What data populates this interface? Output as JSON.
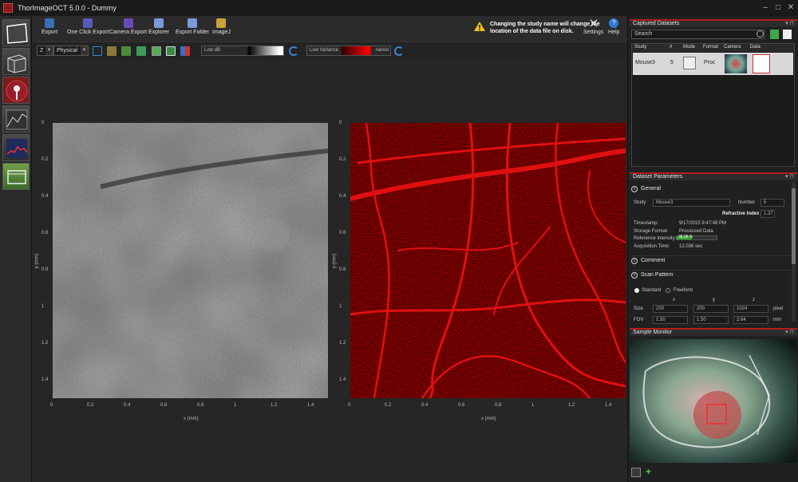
{
  "app": {
    "title": "ThorImageOCT 5.0.0 - Dummy"
  },
  "toolbar": {
    "buttons": [
      "Export",
      "One Click Export",
      "Camera Export",
      "Explorer",
      "Export Folder",
      "ImageJ"
    ],
    "warning": "Changing the study name will change the location of the data file on disk.",
    "settings": "Settings",
    "help": "Help"
  },
  "subbar": {
    "axis": "Z",
    "units": "Physical",
    "slider1": "Low dB",
    "slider2_left": "Low Variance",
    "slider2_right": "riance"
  },
  "plots": {
    "xlabel": "x (mm)",
    "ylabel": "y (mm)",
    "xticks": [
      "0",
      "0.2",
      "0.4",
      "0.6",
      "0.8",
      "1",
      "1.2",
      "1.4"
    ],
    "yticks": [
      "0",
      "0.2",
      "0.4",
      "0.6",
      "0.8",
      "1",
      "1.2",
      "1.4"
    ]
  },
  "captured": {
    "title": "Captured Datasets",
    "search_placeholder": "Search",
    "columns": [
      "Study",
      "#",
      "Mode",
      "Format",
      "Camera",
      "Data"
    ],
    "row": {
      "study": "Mouse3",
      "num": "5",
      "format": "Proc"
    }
  },
  "params": {
    "title": "Dataset Parameters",
    "general": "General",
    "study_label": "Study",
    "study_value": "Mouse3",
    "number_label": "Number",
    "number_value": "5",
    "refractive_label": "Refractive Index",
    "refractive_value": "1.37",
    "timestamp_label": "Timestamp:",
    "timestamp_value": "9/17/2015 9:47:48 PM",
    "storage_label": "Storage Format:",
    "storage_value": "Processed Data",
    "ref_label": "Reference Intensity:",
    "ref_value": "38.08 %",
    "ref_fraction": 0.38,
    "acq_label": "Acquisition Time:",
    "acq_value": "12.036 sec",
    "comment": "Comment",
    "scan": "Scan Pattern",
    "standard": "Standard",
    "freeform": "Freeform",
    "col_x": "x",
    "col_y": "y",
    "col_z": "z",
    "size_label": "Size",
    "size_x": "200",
    "size_y": "200",
    "size_z": "1024",
    "size_unit": "pixel",
    "fov_label": "FOV",
    "fov_x": "1.50",
    "fov_y": "1.50",
    "fov_z": "2.64",
    "fov_unit": "mm"
  },
  "monitor": {
    "title": "Sample Monitor"
  }
}
